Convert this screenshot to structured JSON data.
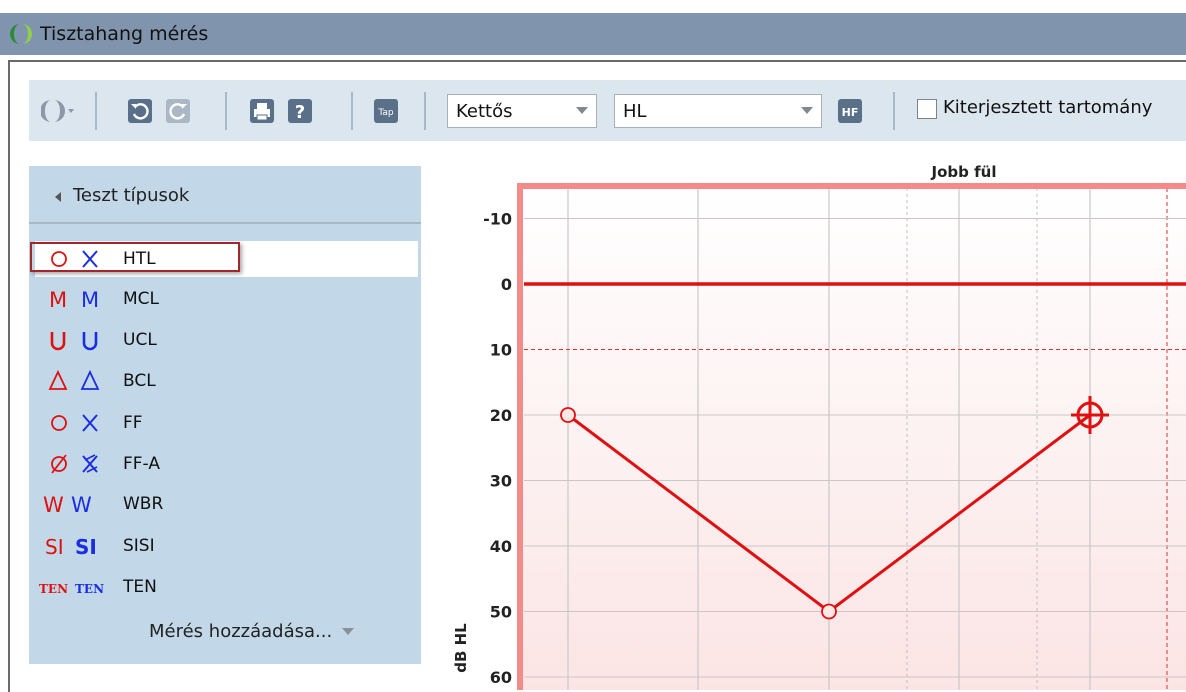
{
  "window": {
    "title": "Tisztahang mérés"
  },
  "toolbar": {
    "icons": [
      "ear-select-icon",
      "undo-icon",
      "redo-icon",
      "print-icon",
      "help-icon",
      "tap-icon",
      "hf-icon"
    ],
    "tap_label": "Tap",
    "hf_label": "HF",
    "mode_select": {
      "value": "Kettős"
    },
    "scale_select": {
      "value": "HL"
    },
    "extended_range": {
      "label": "Kiterjesztett tartomány",
      "checked": false
    }
  },
  "sidebar": {
    "header": "Teszt típusok",
    "items": [
      {
        "label": "HTL",
        "symbols": [
          "O",
          "X"
        ],
        "selected": true
      },
      {
        "label": "MCL",
        "symbols": [
          "M",
          "M"
        ]
      },
      {
        "label": "UCL",
        "symbols": [
          "U",
          "U"
        ]
      },
      {
        "label": "BCL",
        "symbols": [
          "triangle",
          "triangle"
        ]
      },
      {
        "label": "FF",
        "symbols": [
          "O",
          "X"
        ]
      },
      {
        "label": "FF-A",
        "symbols": [
          "Ø",
          "X-slashed"
        ]
      },
      {
        "label": "WBR",
        "symbols": [
          "W",
          "W"
        ]
      },
      {
        "label": "SISI",
        "symbols": [
          "SI",
          "SI"
        ]
      },
      {
        "label": "TEN",
        "symbols": [
          "TEN",
          "TEN"
        ]
      }
    ],
    "add_measurement": "Mérés hozzáadása..."
  },
  "colors": {
    "right_ear": "#e01010",
    "left_ear": "#1a2de0",
    "titlebar": "#8095ad",
    "panel": "#c2d8e8"
  },
  "chart_data": {
    "type": "line",
    "title": "Jobb fül",
    "ylabel": "dB HL",
    "y_ticks": [
      "-10",
      "0",
      "10",
      "20",
      "30",
      "40",
      "50",
      "60"
    ],
    "ylim": [
      -15,
      60
    ],
    "series": [
      {
        "points": [
          {
            "x_index": 0,
            "y": 20
          },
          {
            "x_index": 2,
            "y": 50
          },
          {
            "x_index": 6,
            "y": 20
          }
        ]
      }
    ],
    "current_point": {
      "x_index": 6,
      "y": 20
    },
    "reference_line_y": 0
  }
}
